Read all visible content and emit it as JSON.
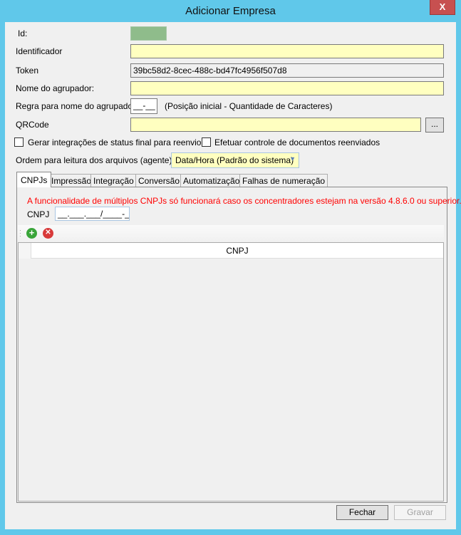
{
  "window": {
    "title": "Adicionar Empresa",
    "close_label": "X"
  },
  "form": {
    "id_label": "Id:",
    "identificador_label": "Identificador",
    "identificador_value": "",
    "token_label": "Token",
    "token_value": "39bc58d2-8cec-488c-bd47fc4956f507d8",
    "nome_label": "Nome do agrupador:",
    "nome_value": "",
    "regra_label": "Regra para nome do agrupador:",
    "regra_value": "__-__",
    "regra_hint": "(Posição inicial - Quantidade de Caracteres)",
    "qrcode_label": "QRCode",
    "qrcode_value": "",
    "browse_label": "...",
    "check1_label": "Gerar integrações de status final para reenvios",
    "check2_label": "Efetuar controle de documentos reenviados",
    "ordem_label": "Ordem para leitura dos arquivos (agente):",
    "ordem_value": "Data/Hora (Padrão do sistema)"
  },
  "tabs": [
    "CNPJs",
    "Impressão",
    "Integração",
    "Conversão",
    "Automatização",
    "Falhas de numeração"
  ],
  "cnpj_tab": {
    "warning": "A funcionalidade de múltiplos CNPJs só funcionará caso os concentradores estejam na versão 4.8.6.0 ou superior.",
    "cnpj_label": "CNPJ",
    "cnpj_mask": "__.___.___/____-__",
    "grid_header": "CNPJ",
    "warning_color": "#ff0000"
  },
  "buttons": {
    "fechar": "Fechar",
    "gravar": "Gravar"
  }
}
